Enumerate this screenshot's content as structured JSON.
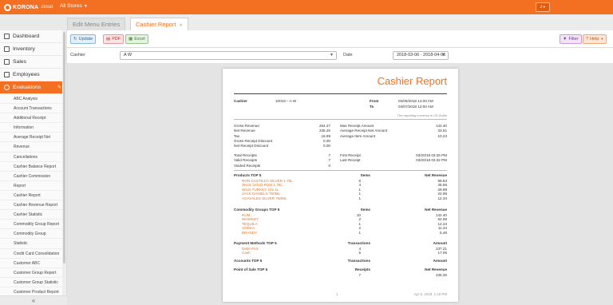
{
  "app": {
    "logo_text": "KORONA",
    "logo_sub": ".cloud",
    "store_selector": "All Stores",
    "bell_icon": "bell-icon"
  },
  "tabs": [
    {
      "label": "Edit Menu Entries"
    },
    {
      "label": "Cashier Report"
    }
  ],
  "sidebar": {
    "main_items": [
      {
        "label": "Dashboard",
        "icon": "dashboard-icon"
      },
      {
        "label": "Inventory",
        "icon": "inventory-icon"
      },
      {
        "label": "Sales",
        "icon": "sales-icon"
      },
      {
        "label": "Employees",
        "icon": "employees-icon"
      },
      {
        "label": "Evaluations",
        "icon": "evaluations-icon"
      }
    ],
    "sub_items": [
      "ABC Analysis",
      "Account Transactions",
      "Additional Receipt",
      "Information",
      "Average Receipt Net",
      "Revenue",
      "Cancellations",
      "Cashier Balance Report",
      "Cashier Commission",
      "Report",
      "Cashier Report",
      "Cashier Revenue Report",
      "Cashier Statistic",
      "Commodity Group Report",
      "Commodity Group",
      "Statistic",
      "Credit Card Consolidation",
      "Customer ABC",
      "Customer Group Report",
      "Customer Group Statistic",
      "Customer Product Report"
    ],
    "collapse_glyph": "«"
  },
  "toolbar": {
    "update": "Update",
    "pdf": "PDF",
    "excel": "Excel",
    "filter": "Filter",
    "help": "Help"
  },
  "filters": {
    "cashier_label": "Cashier",
    "cashier_value": "A W",
    "date_label": "Date",
    "date_value": "2018-03-06 - 2018-04-06"
  },
  "report": {
    "title": "Cashier Report",
    "cashier_label": "Cashier",
    "cashier_value": "10016 – A W",
    "from_label": "From",
    "from_value": "03/06/2018 12:00 AM",
    "to_label": "To",
    "to_value": "04/07/2018 12:00 AM",
    "currency_note": "The reporting currency is US Dollar",
    "stats_left": [
      {
        "label": "Gross Revenue",
        "value": "254.27"
      },
      {
        "label": "Net Revenue",
        "value": "235.26"
      },
      {
        "label": "Tax",
        "value": "18.99"
      },
      {
        "label": "Gross Receipt Discount",
        "value": "0.00"
      },
      {
        "label": "Net Receipt Discount",
        "value": "0.00"
      }
    ],
    "stats_right": [
      {
        "label": "Max Receipt Amount",
        "value": "142.40"
      },
      {
        "label": "Average Receipt Net Amount",
        "value": "33.61"
      },
      {
        "label": "Average Item Amount",
        "value": "10.23"
      }
    ],
    "counts_left": [
      {
        "label": "Total Receipts",
        "value": "7"
      },
      {
        "label": "Valid Receipts",
        "value": "7"
      },
      {
        "label": "Voided Receipts",
        "value": "0"
      }
    ],
    "counts_right": [
      {
        "label": "First Receipt",
        "value": "03/20/18 03:25 PM"
      },
      {
        "label": "Last Receipt",
        "value": "03/20/18 03:32 PM"
      }
    ],
    "products": {
      "title": "Products TOP 5",
      "col1": "Items",
      "col2": "Net Revenue",
      "rows": [
        {
          "name": "RON CASTILLO SILVER 1.75L",
          "items": "6",
          "revenue": "96.84"
        },
        {
          "name": "SKOL GOLD RUM 1.75L",
          "items": "4",
          "revenue": "45.56"
        },
        {
          "name": "WILD TURKEY 101 1L",
          "items": "1",
          "revenue": "29.99"
        },
        {
          "name": "JACK DANIELS 750ML",
          "items": "1",
          "revenue": "22.99"
        },
        {
          "name": "AGAVALES SILVER 750ML",
          "items": "1",
          "revenue": "12.34"
        }
      ]
    },
    "commodity": {
      "title": "Commodity Groups TOP 5",
      "col1": "Items",
      "col2": "Net Revenue",
      "rows": [
        {
          "name": "RUM",
          "items": "10",
          "revenue": "142.40"
        },
        {
          "name": "WHISKEY",
          "items": "2",
          "revenue": "52.98"
        },
        {
          "name": "TEQUILA",
          "items": "1",
          "revenue": "12.34"
        },
        {
          "name": "VODKA",
          "items": "2",
          "revenue": "11.34"
        },
        {
          "name": "BRANDY",
          "items": "1",
          "revenue": "5.49"
        }
      ]
    },
    "payments": {
      "title": "Payment Methods TOP 5",
      "col1": "Transactions",
      "col2": "Amount",
      "rows": [
        {
          "name": "Debit PAX",
          "items": "4",
          "revenue": "237.21"
        },
        {
          "name": "Cash",
          "items": "5",
          "revenue": "17.06"
        }
      ]
    },
    "accounts": {
      "title": "Accounts TOP 5",
      "col1": "Transactions",
      "col2": "Amount"
    },
    "pos": {
      "title": "Point of Sale TOP 5",
      "col1": "Receipts",
      "col2": "Net Revenue",
      "rows": [
        {
          "name": "",
          "items": "7",
          "revenue": "235.26"
        }
      ]
    },
    "page_number": "1",
    "page_date": "Apr 6, 2018, 1:19 PM"
  }
}
